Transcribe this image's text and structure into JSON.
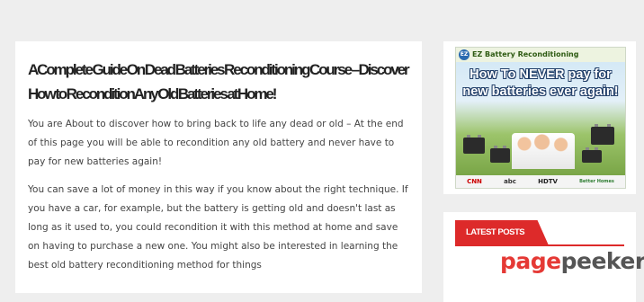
{
  "article": {
    "title": "A Complete Guide On Dead Batteries Reconditioning Course – Discover How to Recondition Any Old Batteries at Home!",
    "paragraphs": [
      "You are About to discover how to bring back to life any dead or old – At the end of this page you will be able to recondition any old battery and never have to pay for new batteries again!",
      "You can save a lot of money in this way if you know about the right technique. If you have a car, for example, but the battery is getting old and doesn't last as long as it used to, you could recondition it with this method at home and save on having to purchase a new one. You might also be interested in learning the best old battery reconditioning method for things"
    ]
  },
  "sidebar": {
    "ad": {
      "top_bar": "EZ Battery Reconditioning",
      "badge": "EZ",
      "headline": "How To NEVER pay for new batteries ever again!",
      "logos": [
        "CNN",
        "abc",
        "HDTV",
        "Better Homes"
      ]
    },
    "latest_posts_label": "LATEST POSTS"
  },
  "watermark": {
    "part1": "page",
    "part2": "peeker"
  },
  "colors": {
    "accent": "#dd2a2a",
    "background": "#eeeeee"
  }
}
